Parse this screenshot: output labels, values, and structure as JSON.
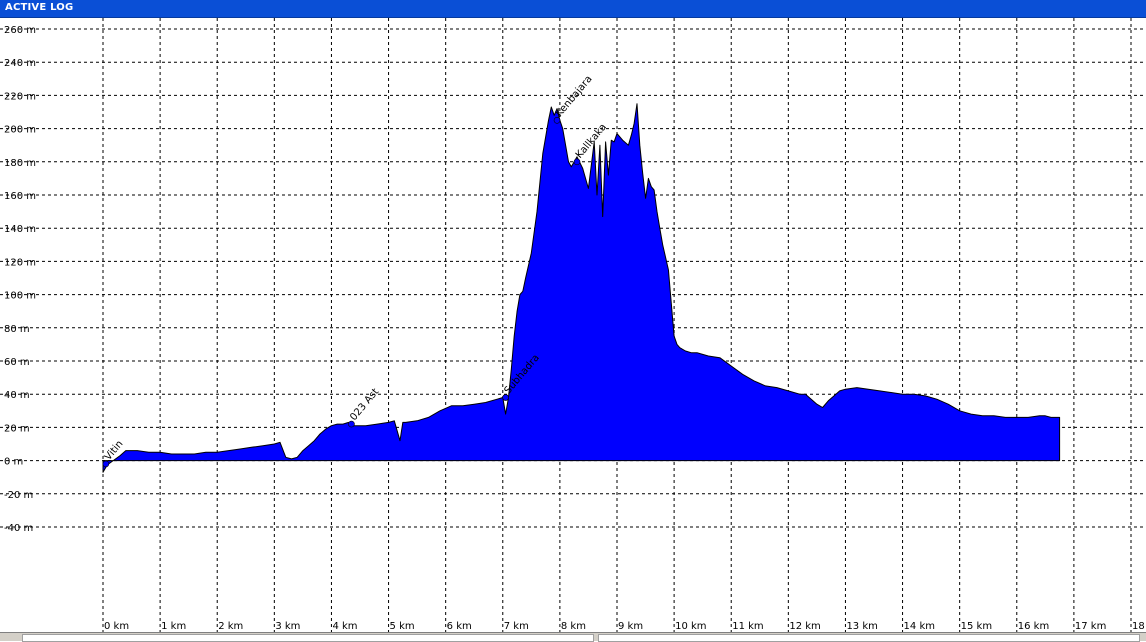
{
  "window": {
    "title": "ACTIVE LOG"
  },
  "colors": {
    "fill": "#0000ff",
    "outline": "#000000",
    "waypoint": "#0000ff",
    "titlebar": "#0a4fd6"
  },
  "chart_data": {
    "type": "area",
    "title": "",
    "xlabel": "",
    "ylabel": "",
    "x_unit": "km",
    "y_unit": "m",
    "xlim": [
      0,
      18
    ],
    "ylim": [
      -40,
      260
    ],
    "grid": true,
    "x_ticks": [
      "0 km",
      "1 km",
      "2 km",
      "3 km",
      "4 km",
      "5 km",
      "6 km",
      "7 km",
      "8 km",
      "9 km",
      "10 km",
      "11 km",
      "12 km",
      "13 km",
      "14 km",
      "15 km",
      "16 km",
      "17 km",
      "18 km"
    ],
    "y_ticks": [
      "260 m",
      "240 m",
      "220 m",
      "200 m",
      "180 m",
      "160 m",
      "140 m",
      "120 m",
      "100 m",
      "80 m",
      "60 m",
      "40 m",
      "20 m",
      "0 m",
      "-20 m",
      "-40 m"
    ],
    "series": [
      {
        "x": [
          0,
          0.05,
          0.1,
          0.3,
          0.4,
          0.6,
          0.8,
          1.0,
          1.2,
          1.4,
          1.6,
          1.8,
          2.0,
          2.2,
          2.4,
          2.6,
          2.8,
          3.0,
          3.1,
          3.2,
          3.3,
          3.4,
          3.5,
          3.6,
          3.7,
          3.8,
          3.9,
          4.0,
          4.1,
          4.2,
          4.3,
          4.35,
          4.4,
          4.6,
          4.8,
          5.0,
          5.1,
          5.2,
          5.25,
          5.3,
          5.5,
          5.7,
          5.9,
          6.1,
          6.3,
          6.5,
          6.7,
          6.9,
          7.0,
          7.05,
          7.1,
          7.15,
          7.2,
          7.25,
          7.3,
          7.35,
          7.4,
          7.5,
          7.6,
          7.7,
          7.8,
          7.85,
          7.9,
          7.95,
          8.0,
          8.05,
          8.1,
          8.15,
          8.2,
          8.3,
          8.4,
          8.5,
          8.6,
          8.65,
          8.7,
          8.75,
          8.8,
          8.85,
          8.9,
          8.95,
          9.0,
          9.1,
          9.2,
          9.25,
          9.3,
          9.35,
          9.4,
          9.45,
          9.5,
          9.55,
          9.6,
          9.65,
          9.7,
          9.75,
          9.8,
          9.9,
          10.0,
          10.05,
          10.1,
          10.2,
          10.3,
          10.4,
          10.5,
          10.6,
          10.8,
          11.0,
          11.2,
          11.4,
          11.6,
          11.8,
          12.0,
          12.2,
          12.3,
          12.4,
          12.5,
          12.6,
          12.7,
          12.8,
          12.9,
          13.0,
          13.2,
          13.4,
          13.6,
          13.8,
          14.0,
          14.2,
          14.4,
          14.6,
          14.8,
          15.0,
          15.2,
          15.4,
          15.6,
          15.8,
          16.0,
          16.2,
          16.4,
          16.5,
          16.6,
          16.7,
          16.75
        ],
        "y": [
          -7,
          -4,
          -2,
          3,
          6,
          6,
          5,
          5,
          4,
          4,
          4,
          5,
          5,
          6,
          7,
          8,
          9,
          10,
          11,
          2,
          1,
          2,
          6,
          9,
          12,
          16,
          19,
          21,
          22,
          22,
          23,
          21,
          21,
          21,
          22,
          23,
          24,
          12,
          23,
          23,
          24,
          26,
          30,
          33,
          33,
          34,
          35,
          37,
          38,
          28,
          38,
          55,
          75,
          90,
          100,
          102,
          110,
          125,
          150,
          185,
          205,
          213,
          208,
          212,
          205,
          200,
          190,
          180,
          177,
          183,
          176,
          164,
          192,
          160,
          190,
          147,
          192,
          172,
          193,
          192,
          197,
          193,
          190,
          196,
          203,
          215,
          190,
          173,
          158,
          170,
          165,
          163,
          150,
          140,
          130,
          115,
          75,
          70,
          68,
          66,
          65,
          65,
          64,
          63,
          62,
          57,
          52,
          48,
          45,
          44,
          42,
          40,
          40,
          37,
          34,
          32,
          36,
          39,
          42,
          43,
          44,
          43,
          42,
          41,
          40,
          40,
          39,
          37,
          34,
          30,
          28,
          27,
          27,
          26,
          26,
          26,
          27,
          27,
          26,
          26,
          26
        ]
      }
    ],
    "waypoints": [
      {
        "label": "Vitin",
        "x": 0.05,
        "y": -2
      },
      {
        "label": "023 Ast",
        "x": 4.35,
        "y": 22
      },
      {
        "label": "Subhadra",
        "x": 7.05,
        "y": 38
      },
      {
        "label": "Kenbajara",
        "x": 7.95,
        "y": 205
      },
      {
        "label": "Kallkaka",
        "x": 8.3,
        "y": 180
      }
    ]
  }
}
